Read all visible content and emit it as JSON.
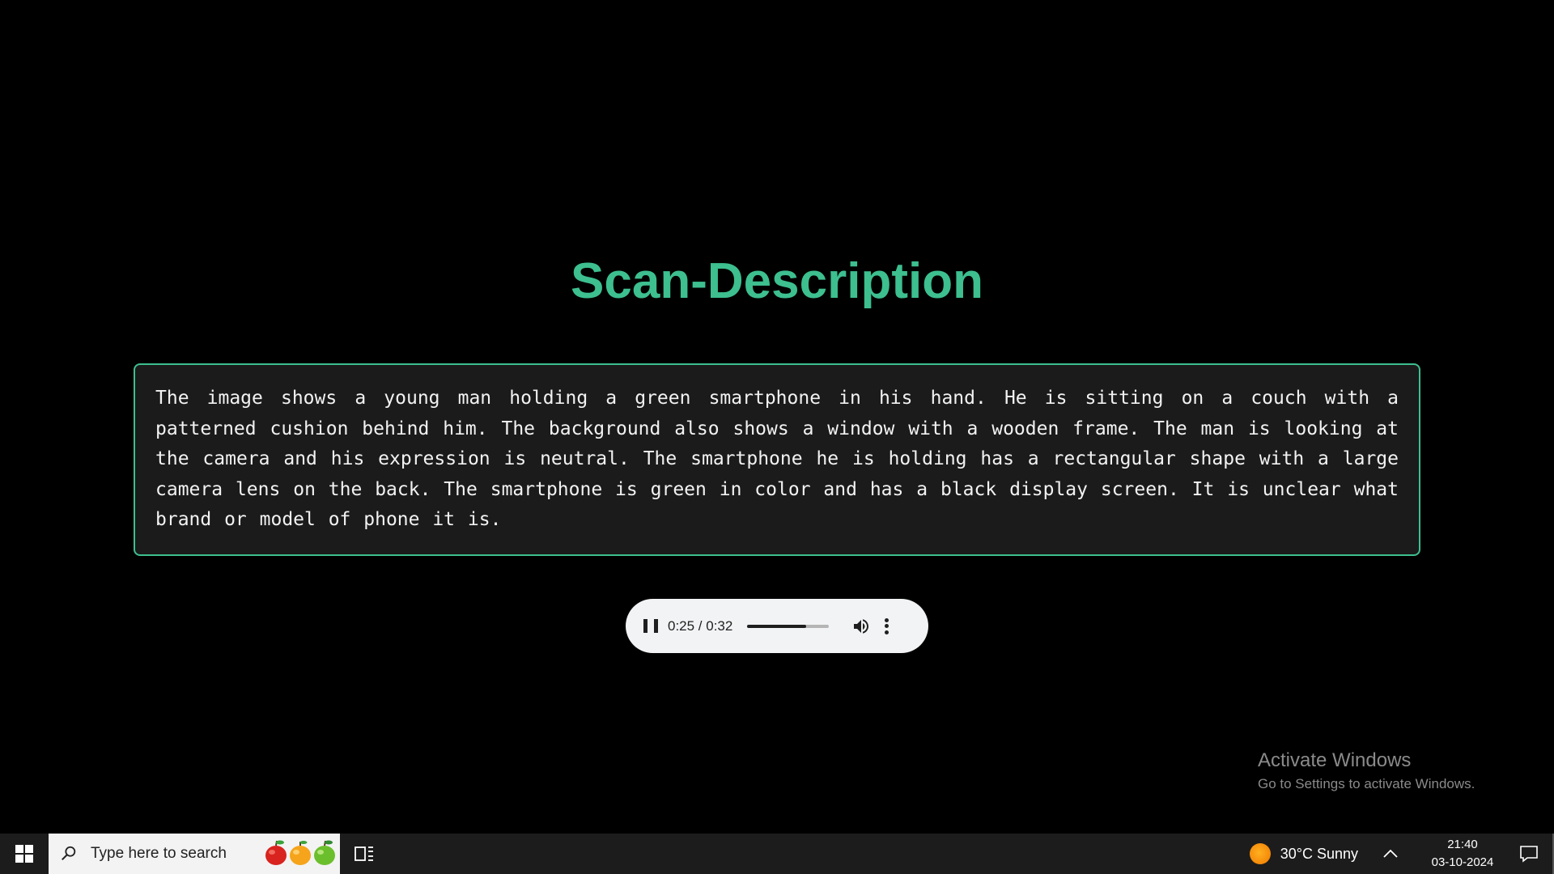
{
  "page": {
    "title": "Scan-Description",
    "description": "The image shows a young man holding a green smartphone in his hand. He is sitting on a couch with a patterned cushion behind him. The background also shows a window with a wooden frame. The man is looking at the camera and his expression is neutral.  The smartphone he is holding has a rectangular shape with a large camera lens on the back.  The smartphone is green in color and has a black display screen.  It is unclear what brand or model of phone it is."
  },
  "audio_player": {
    "time_display": "0:25 / 0:32",
    "progress_fraction": 0.72,
    "state": "playing",
    "icons": [
      "pause-icon",
      "volume-icon",
      "more-options-icon"
    ]
  },
  "watermark": {
    "title": "Activate Windows",
    "subtitle": "Go to Settings to activate Windows."
  },
  "taskbar": {
    "search_placeholder": "Type here to search",
    "weather": "30°C  Sunny",
    "time": "21:40",
    "date": "03-10-2024",
    "icons": [
      "windows-start-icon",
      "search-icon",
      "fruit-icons",
      "task-view-icon",
      "sun-icon",
      "chevron-up-icon",
      "notification-icon"
    ]
  },
  "colors": {
    "accent": "#3dbf8f",
    "background": "#000000",
    "box_background": "#1b1b1b",
    "taskbar": "#1c1c1c"
  }
}
